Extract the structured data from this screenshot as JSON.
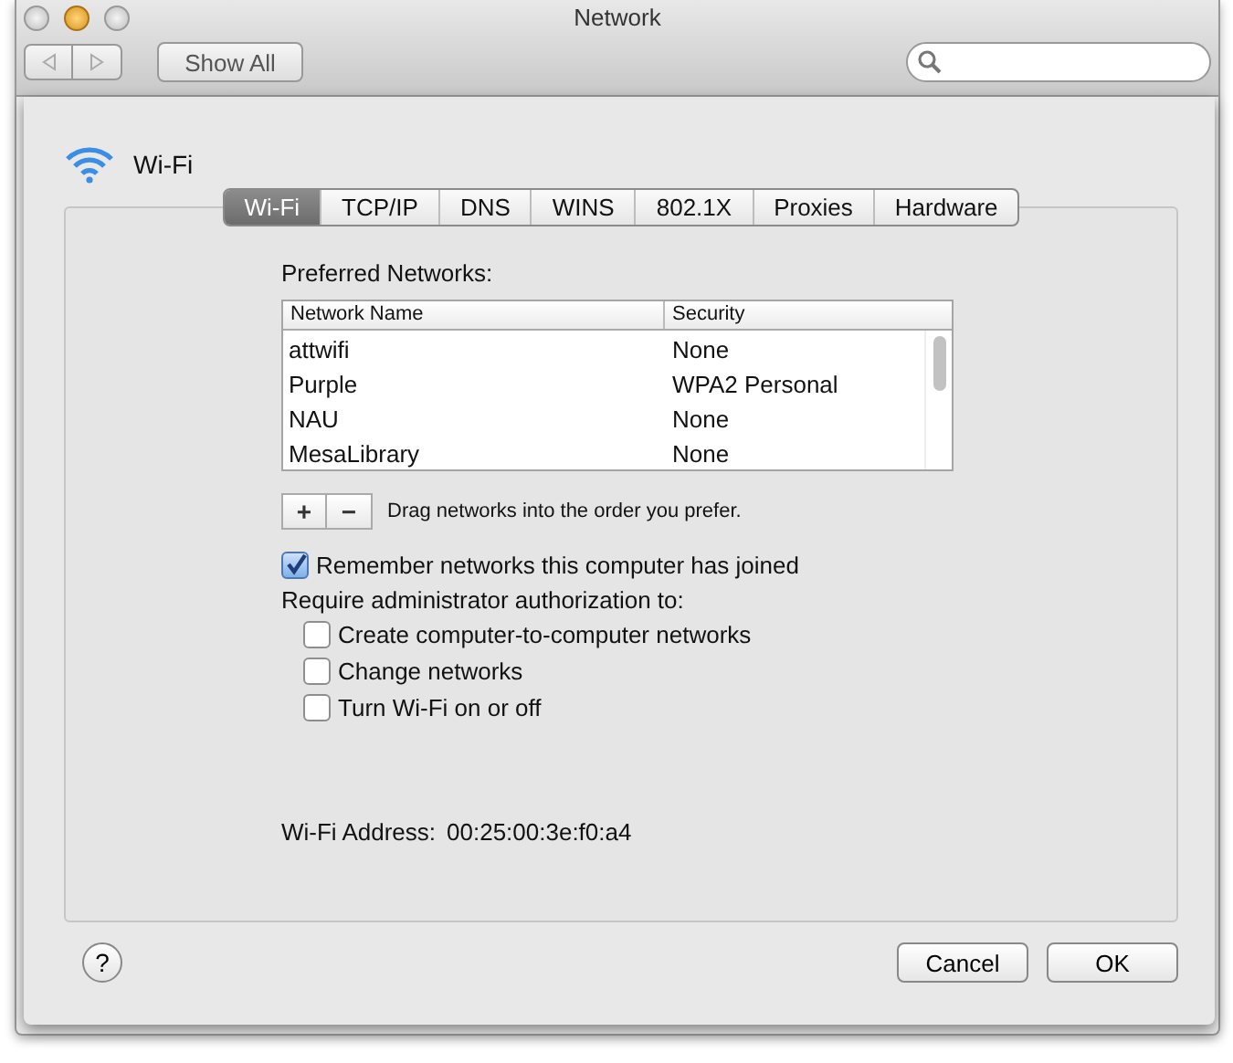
{
  "window": {
    "title": "Network",
    "show_all": "Show All"
  },
  "sheet": {
    "service": "Wi-Fi",
    "tabs": [
      {
        "label": "Wi-Fi",
        "selected": true
      },
      {
        "label": "TCP/IP",
        "selected": false
      },
      {
        "label": "DNS",
        "selected": false
      },
      {
        "label": "WINS",
        "selected": false
      },
      {
        "label": "802.1X",
        "selected": false
      },
      {
        "label": "Proxies",
        "selected": false
      },
      {
        "label": "Hardware",
        "selected": false
      }
    ],
    "preferred_label": "Preferred Networks:",
    "table": {
      "columns": [
        "Network Name",
        "Security"
      ],
      "rows": [
        [
          "attwifi",
          "None"
        ],
        [
          "Purple",
          "WPA2 Personal"
        ],
        [
          "NAU",
          "None"
        ],
        [
          "MesaLibrary",
          "None"
        ]
      ]
    },
    "add": "+",
    "remove": "−",
    "drag_hint": "Drag networks into the order you prefer.",
    "remember": {
      "label": "Remember networks this computer has joined",
      "checked": true
    },
    "require_label": "Require administrator authorization to:",
    "options": [
      {
        "label": "Create computer-to-computer networks",
        "checked": false
      },
      {
        "label": "Change networks",
        "checked": false
      },
      {
        "label": "Turn Wi-Fi on or off",
        "checked": false
      }
    ],
    "address_label": "Wi-Fi Address:",
    "address": "00:25:00:3e:f0:a4",
    "help": "?",
    "cancel": "Cancel",
    "ok": "OK"
  }
}
